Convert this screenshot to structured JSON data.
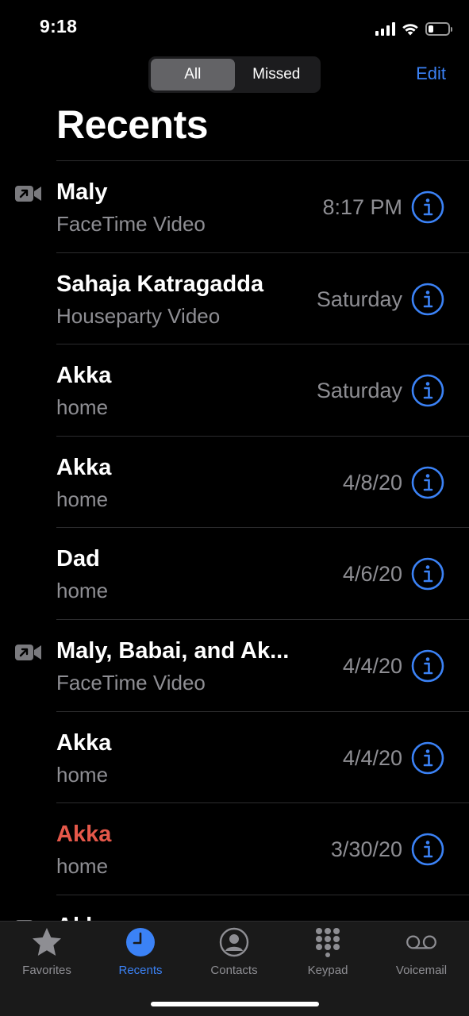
{
  "status_bar": {
    "time": "9:18",
    "battery_level": 0.25
  },
  "segmented_control": {
    "options": [
      "All",
      "Missed"
    ],
    "selected": "All"
  },
  "header": {
    "edit_label": "Edit",
    "title": "Recents"
  },
  "calls": [
    {
      "name": "Maly",
      "type": "FaceTime Video",
      "date": "8:17 PM",
      "video": true,
      "missed": false
    },
    {
      "name": "Sahaja Katragadda",
      "type": "Houseparty Video",
      "date": "Saturday",
      "video": false,
      "missed": false
    },
    {
      "name": "Akka",
      "type": "home",
      "date": "Saturday",
      "video": false,
      "missed": false
    },
    {
      "name": "Akka",
      "type": "home",
      "date": "4/8/20",
      "video": false,
      "missed": false
    },
    {
      "name": "Dad",
      "type": "home",
      "date": "4/6/20",
      "video": false,
      "missed": false
    },
    {
      "name": "Maly, Babai, and Ak...",
      "type": "FaceTime Video",
      "date": "4/4/20",
      "video": true,
      "missed": false
    },
    {
      "name": "Akka",
      "type": "home",
      "date": "4/4/20",
      "video": false,
      "missed": false
    },
    {
      "name": "Akka",
      "type": "home",
      "date": "3/30/20",
      "video": false,
      "missed": true
    },
    {
      "name": "Akka",
      "type": "",
      "date": "",
      "video": true,
      "missed": false
    }
  ],
  "tab_bar": {
    "items": [
      {
        "label": "Favorites",
        "icon": "star-icon"
      },
      {
        "label": "Recents",
        "icon": "clock-icon"
      },
      {
        "label": "Contacts",
        "icon": "person-circle-icon"
      },
      {
        "label": "Keypad",
        "icon": "keypad-icon"
      },
      {
        "label": "Voicemail",
        "icon": "voicemail-icon"
      }
    ],
    "selected": "Recents"
  },
  "colors": {
    "accent": "#3b82f6",
    "missed": "#e5584a",
    "secondary_text": "#8e8e93",
    "background": "#000000"
  }
}
